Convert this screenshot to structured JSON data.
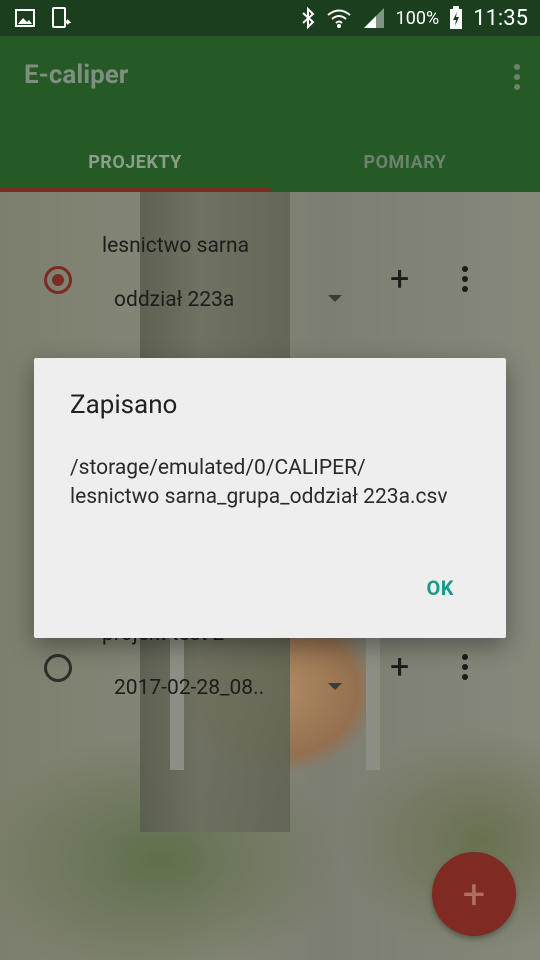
{
  "status_bar": {
    "battery": "100%",
    "time": "11:35",
    "icons": [
      "image-icon",
      "device-sync-icon",
      "bluetooth-icon",
      "wifi-icon",
      "signal-icon",
      "battery-charging-icon"
    ]
  },
  "app_bar": {
    "title": "E-caliper",
    "tabs": [
      {
        "label": "PROJEKTY",
        "active": true
      },
      {
        "label": "POMIARY",
        "active": false
      }
    ]
  },
  "projects": [
    {
      "name": "lesnictwo sarna",
      "selection": "oddział 223a",
      "selected": true
    },
    {
      "name": "projekt test 2",
      "selection": "2017-02-28_08..",
      "selected": false
    }
  ],
  "fab": {
    "label": "+"
  },
  "dialog": {
    "title": "Zapisano",
    "message": "/storage/emulated/0/CALIPER/\nlesnictwo sarna_grupa_oddział 223a.csv",
    "ok_label": "OK"
  },
  "colors": {
    "primary": "#255a26",
    "status_bar": "#1b3f1e",
    "accent": "#7f2a22",
    "dialog_button": "#1a9a8a"
  }
}
